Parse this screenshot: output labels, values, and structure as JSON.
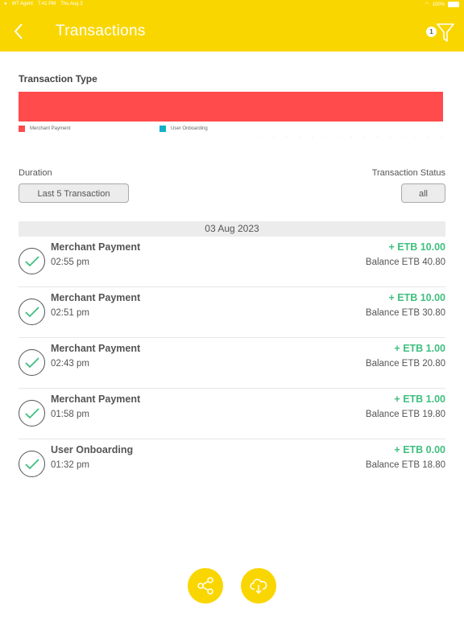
{
  "status_bar": {
    "carrier": "WT Agent",
    "time": "7:41 PM",
    "date": "Thu Aug 3",
    "battery": "100%"
  },
  "header": {
    "title": "Transactions",
    "filter_count": "1"
  },
  "transaction_type": {
    "title": "Transaction Type",
    "legend": [
      {
        "label": "Merchant Payment",
        "color": "#ff4b4b"
      },
      {
        "label": "User Onboarding",
        "color": "#12b0c8"
      }
    ],
    "share": {
      "Merchant Payment": 1.0,
      "User Onboarding": 0.0
    }
  },
  "filters": {
    "duration_label": "Duration",
    "duration_value": "Last 5 Transaction",
    "status_label": "Transaction Status",
    "status_value": "all"
  },
  "date_group": "03 Aug 2023",
  "transactions": [
    {
      "name": "Merchant Payment",
      "time": "02:55 pm",
      "amount": "+ ETB 10.00",
      "balance": "Balance ETB 40.80"
    },
    {
      "name": "Merchant Payment",
      "time": "02:51 pm",
      "amount": "+ ETB 10.00",
      "balance": "Balance ETB 30.80"
    },
    {
      "name": "Merchant Payment",
      "time": "02:43 pm",
      "amount": "+ ETB 1.00",
      "balance": "Balance ETB 20.80"
    },
    {
      "name": "Merchant Payment",
      "time": "01:58 pm",
      "amount": "+ ETB 1.00",
      "balance": "Balance ETB 19.80"
    },
    {
      "name": "User Onboarding",
      "time": "01:32 pm",
      "amount": "+ ETB 0.00",
      "balance": "Balance ETB 18.80"
    }
  ],
  "actions": {
    "share_icon": "share-icon",
    "download_icon": "cloud-download-icon"
  },
  "colors": {
    "accent": "#fad600",
    "positive": "#3fbf7f"
  }
}
